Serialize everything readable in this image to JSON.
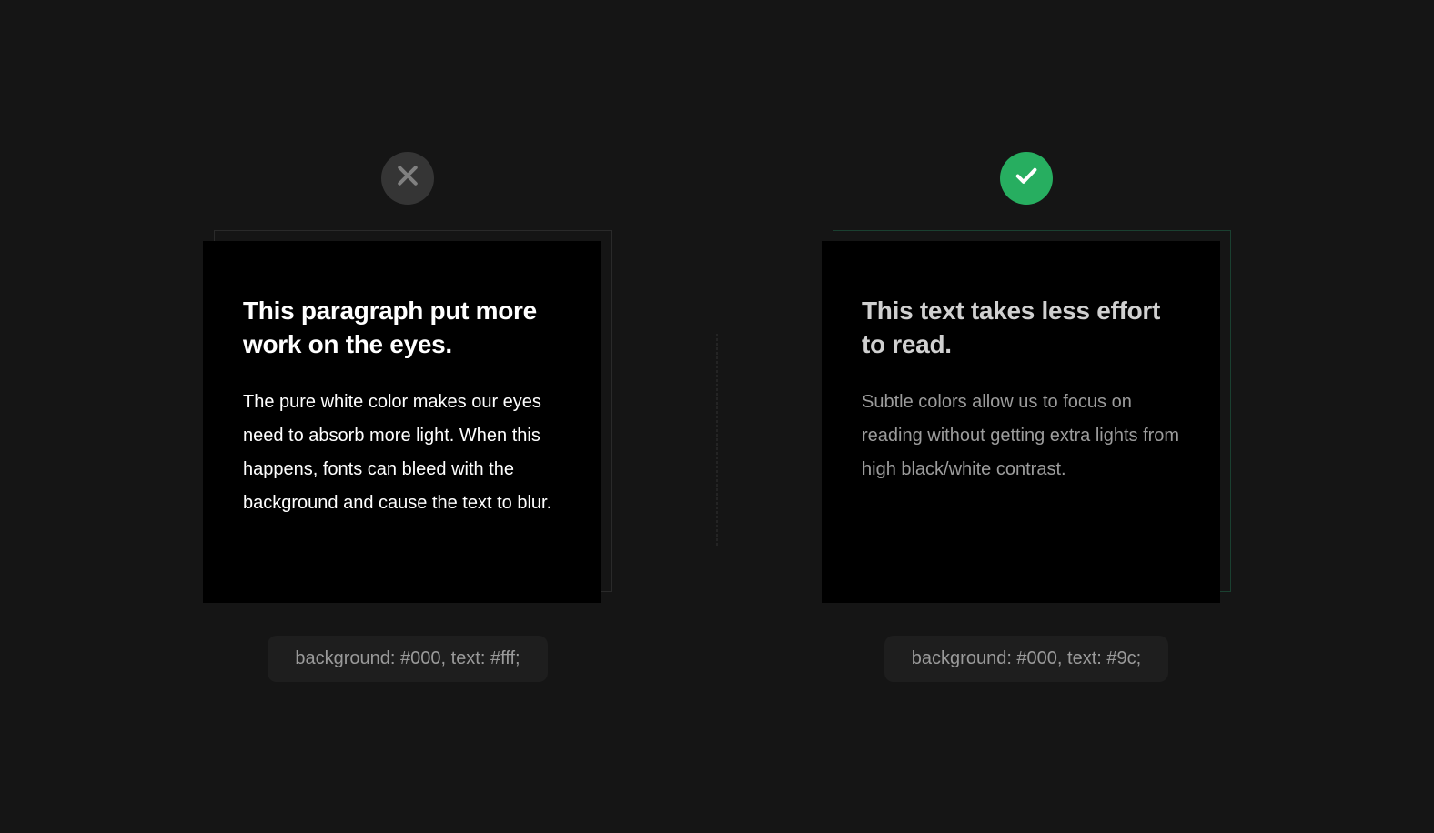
{
  "left": {
    "badge": "cross",
    "heading": "This paragraph put more work on the eyes.",
    "body": "The pure white color makes our eyes need to absorb more light. When this happens, fonts can bleed with the background and cause the text to blur.",
    "caption": "background: #000, text: #fff;",
    "colors": {
      "background": "#000",
      "text": "#fff"
    }
  },
  "right": {
    "badge": "check",
    "heading": "This text takes less effort to read.",
    "body": "Subtle colors allow us to focus on reading without getting extra lights from high black/white contrast.",
    "caption": "background: #000, text: #9c;",
    "colors": {
      "background": "#000",
      "text": "#9c"
    }
  }
}
